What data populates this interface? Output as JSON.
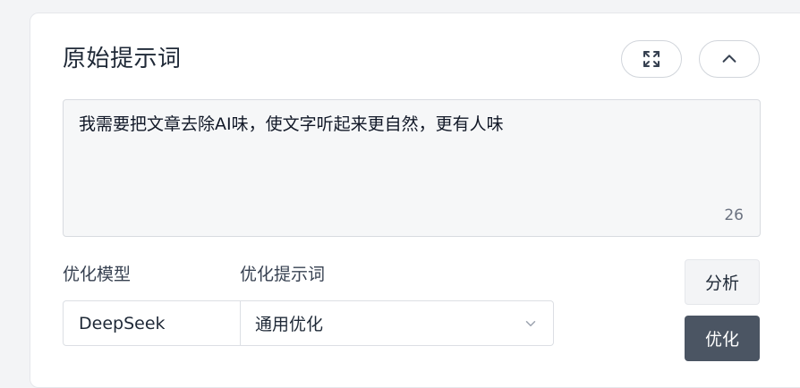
{
  "panel": {
    "title": "原始提示词",
    "expand_icon": "expand-arrows-icon",
    "collapse_icon": "chevron-up-icon"
  },
  "prompt_input": {
    "value": "我需要把文章去除AI味，使文字听起来更自然，更有人味",
    "char_count": "26"
  },
  "controls": {
    "model_label": "优化模型",
    "prompt_label": "优化提示词",
    "model_value": "DeepSeek",
    "prompt_value": "通用优化",
    "analyze_label": "分析",
    "optimize_label": "优化"
  },
  "colors": {
    "primary_button": "#4b5563",
    "secondary_button": "#f3f4f6",
    "input_background": "#f6f7f8"
  }
}
